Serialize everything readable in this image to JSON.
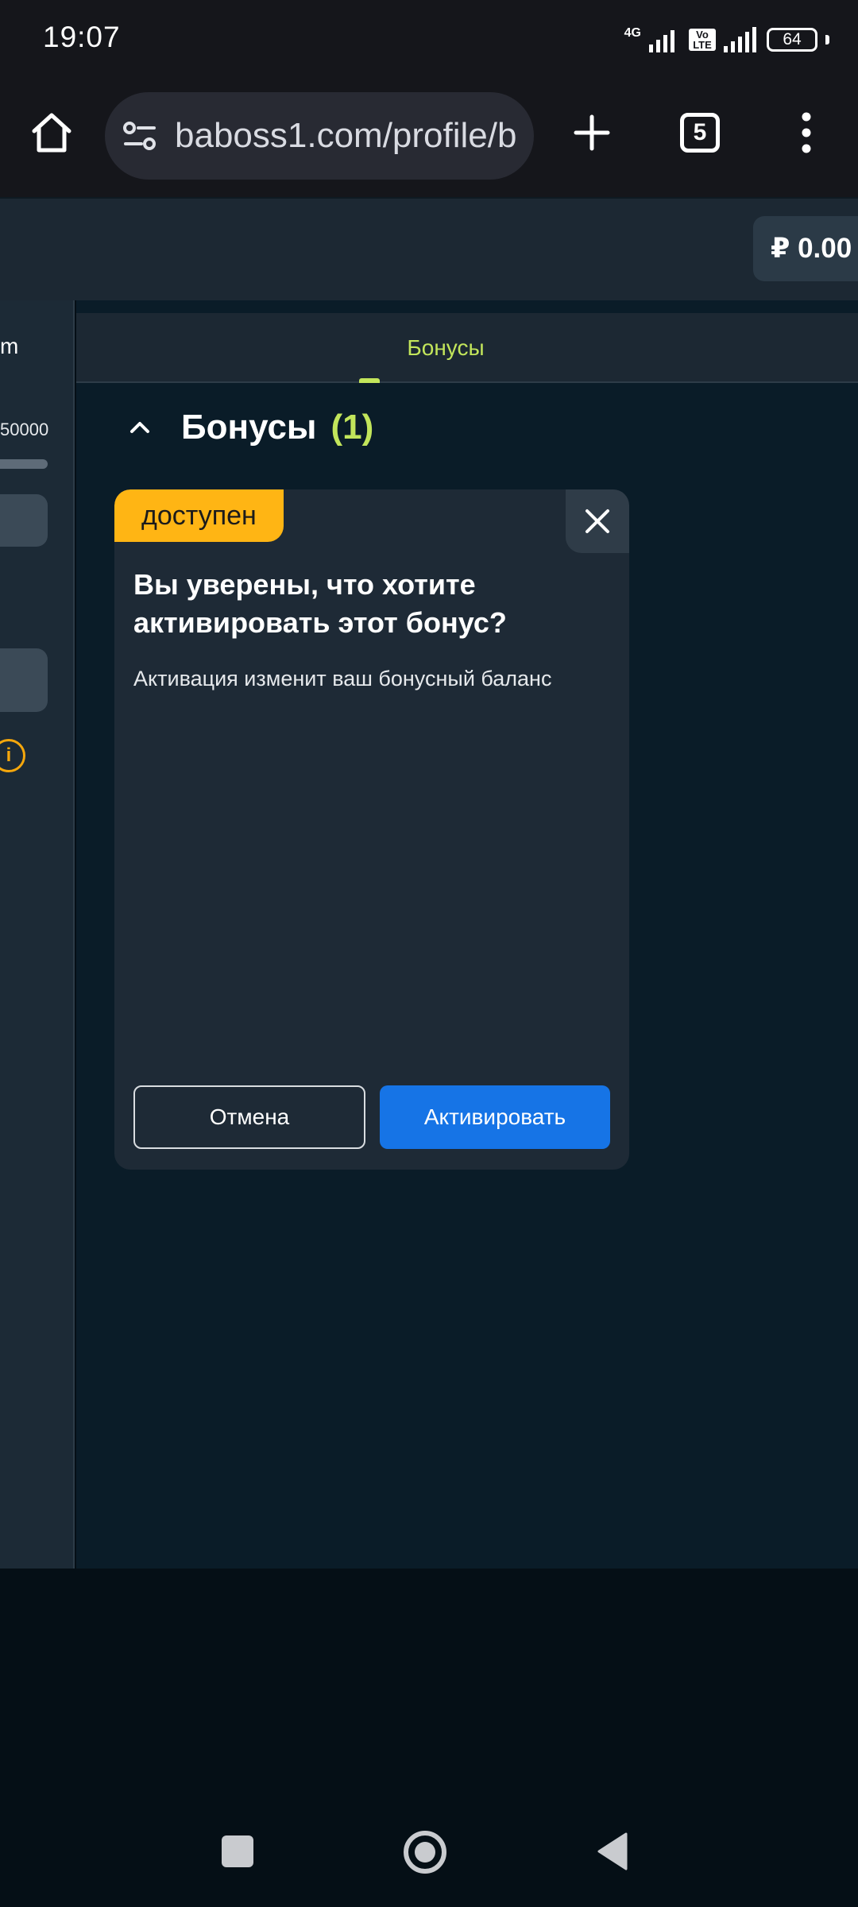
{
  "status_bar": {
    "time": "19:07",
    "network": "4G",
    "volte": "Vo LTE",
    "battery": "64"
  },
  "browser": {
    "url": "baboss1.com/profile/b",
    "tab_count": "5"
  },
  "header": {
    "balance": "₽ 0.00"
  },
  "sidebar": {
    "fragment_top": "m",
    "fragment_amount": "50000",
    "info_symbol": "i"
  },
  "tabs": {
    "active_label": "Бонусы"
  },
  "section": {
    "title": "Бонусы",
    "count": "(1)"
  },
  "dialog": {
    "badge": "доступен",
    "title": "Вы уверены, что хотите активировать этот бонус?",
    "description": "Активация изменит ваш бонусный баланс",
    "cancel_label": "Отмена",
    "activate_label": "Активировать"
  },
  "colors": {
    "accent_green": "#c2e55b",
    "badge_yellow": "#ffb514",
    "primary_blue": "#1674e6",
    "card_bg": "#1e2a36",
    "page_bg": "#0a1c28"
  }
}
